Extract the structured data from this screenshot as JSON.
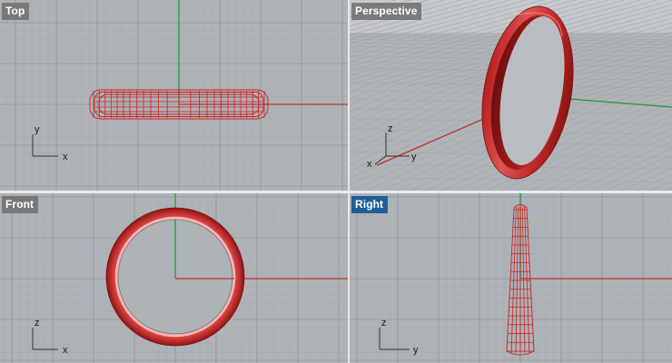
{
  "viewports": {
    "top": {
      "label": "Top",
      "active": false,
      "axis_h": "x",
      "axis_v": "y"
    },
    "perspective": {
      "label": "Perspective",
      "active": false,
      "axis_h": "y",
      "axis_v": "z",
      "axis_d": "x"
    },
    "front": {
      "label": "Front",
      "active": false,
      "axis_h": "x",
      "axis_v": "z"
    },
    "right": {
      "label": "Right",
      "active": true,
      "axis_h": "y",
      "axis_v": "z"
    }
  },
  "colors": {
    "viewport_bg": "#aeb3b8",
    "grid_line": "#9ea3a8",
    "grid_major": "#8d9297",
    "x_axis": "#c0302f",
    "y_axis": "#1f9a3a",
    "object": "#cc2222",
    "active_tab": "#1f5e96"
  },
  "icons": {
    "axis_widget": "axis-gizmo-icon"
  }
}
